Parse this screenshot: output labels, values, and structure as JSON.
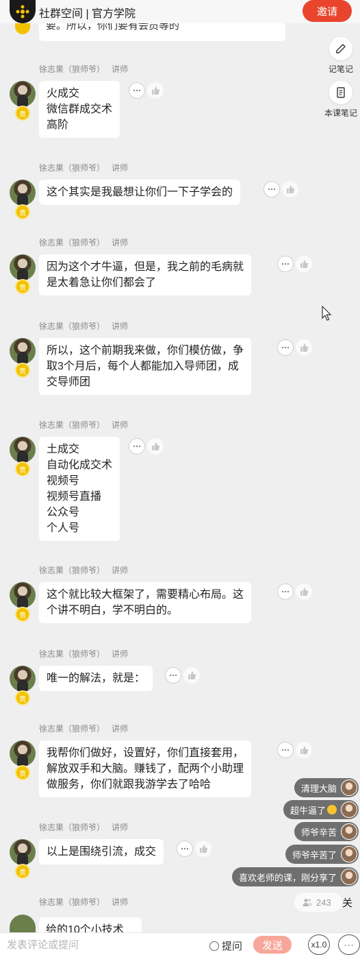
{
  "header": {
    "title": "社群空间 | 官方学院",
    "invite_label": "邀请"
  },
  "tools": {
    "notes_label": "记笔记",
    "course_notes_label": "本课笔记"
  },
  "partial_top_text": "要。所以，你们要有会员等的",
  "sender": {
    "name": "徐志果（狼师爷）",
    "role": "讲师"
  },
  "badge_text": "贵",
  "messages": [
    {
      "lines": [
        "火成交",
        "微信群成交术",
        "高阶"
      ]
    },
    {
      "lines": [
        "这个其实是我最想让你们一下子学会的"
      ]
    },
    {
      "lines": [
        "因为这个才牛逼，但是，我之前的毛病就",
        "是太着急让你们都会了"
      ]
    },
    {
      "lines": [
        "所以，这个前期我来做，你们模仿做，争",
        "取3个月后，每个人都能加入导师团，成",
        "交导师团"
      ]
    },
    {
      "lines": [
        "土成交",
        "自动化成交术",
        "视频号",
        "视频号直播",
        "公众号",
        "个人号"
      ]
    },
    {
      "lines": [
        "这个就比较大框架了，需要精心布局。这",
        "个讲不明白，学不明白的。"
      ]
    },
    {
      "lines": [
        "唯一的解法，就是："
      ]
    },
    {
      "lines": [
        "我帮你们做好，设置好，你们直接套用，",
        "解放双手和大脑。赚钱了，配两个小助理",
        "做服务，你们就跟我游学去了哈哈"
      ]
    },
    {
      "lines": [
        "以上是围绕引流，成交"
      ]
    }
  ],
  "partial_bottom_text": "给的10个小技术",
  "danmu": [
    {
      "text": "清理大脑"
    },
    {
      "text": "超牛逼了"
    },
    {
      "text": "师爷辛苦"
    },
    {
      "text": "师爷辛苦了"
    },
    {
      "text": "喜欢老师的课，刚分享了"
    }
  ],
  "viewers": {
    "count": "243",
    "close_label": "关"
  },
  "bottom_bar": {
    "input_placeholder": "发表评论或提问",
    "ask_label": "提问",
    "send_label": "发送",
    "speed_label": "x1.0",
    "more_label": "···"
  }
}
